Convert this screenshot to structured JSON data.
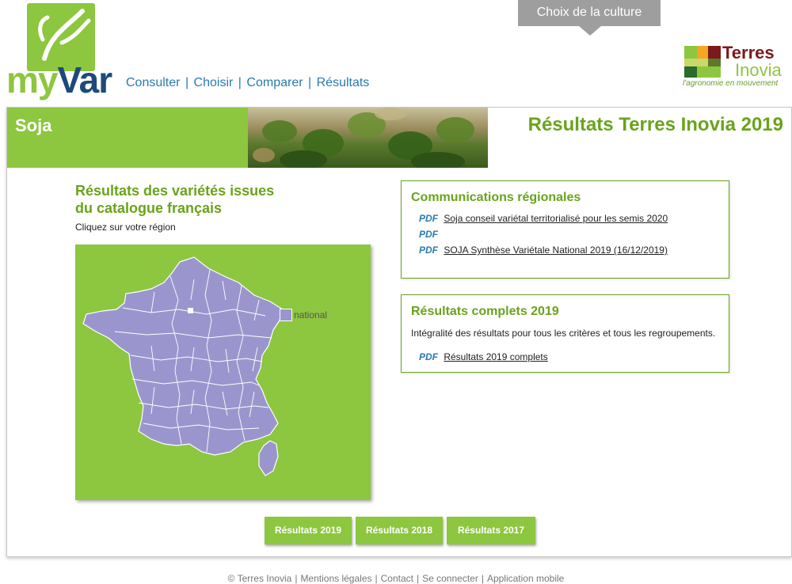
{
  "brand": {
    "logo_text_prefix": "my",
    "logo_text_suffix": "Var",
    "partner_name_line1": "Terres",
    "partner_name_line2": "Inovia",
    "partner_tagline": "l'agronomie en mouvement"
  },
  "nav": {
    "items": [
      "Consulter",
      "Choisir",
      "Comparer",
      "Résultats"
    ],
    "separator": "|"
  },
  "culture_selector": {
    "label": "Choix de la culture"
  },
  "banner": {
    "crop": "Soja",
    "title": "Résultats Terres Inovia 2019"
  },
  "left": {
    "title_line1": "Résultats des variétés issues",
    "title_line2": "du catalogue français",
    "instruction": "Cliquez sur votre région",
    "legend_label": "national"
  },
  "regional": {
    "title": "Communications régionales",
    "items": [
      {
        "tag": "PDF",
        "text": "Soja conseil variétal territorialisé pour les semis 2020"
      },
      {
        "tag": "PDF",
        "text": ""
      },
      {
        "tag": "PDF",
        "text": "SOJA Synthèse Variétale National 2019 (16/12/2019)"
      }
    ]
  },
  "complete": {
    "title": "Résultats complets 2019",
    "description": "Intégralité des résultats pour tous les critères et tous les regroupements.",
    "items": [
      {
        "tag": "PDF",
        "text": "Résultats 2019 complets"
      }
    ]
  },
  "year_buttons": [
    "Résultats 2019",
    "Résultats 2018",
    "Résultats 2017"
  ],
  "footer": {
    "links": [
      "© Terres Inovia",
      "Mentions légales",
      "Contact",
      "Se connecter",
      "Application mobile"
    ]
  },
  "colors": {
    "brand_green": "#8dc63f",
    "title_green": "#6aa31b",
    "link_blue": "#2a7ab0",
    "map_fill": "#9a96cd",
    "selector_grey": "#9e9e9e"
  }
}
